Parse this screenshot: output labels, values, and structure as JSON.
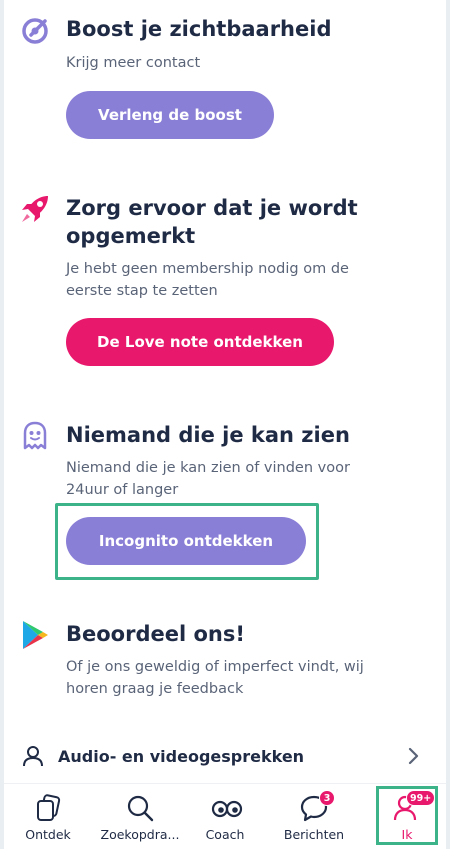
{
  "sections": [
    {
      "title": "Boost je zichtbaarheid",
      "description": "Krijg meer contact",
      "button_label": "Verleng de boost",
      "icon": "boost-icon"
    },
    {
      "title_lines": [
        "Zorg ervoor dat je wordt",
        "opgemerkt"
      ],
      "description_lines": [
        "Je hebt geen membership nodig om de",
        "eerste stap te zetten"
      ],
      "button_label": "De Love note ontdekken",
      "icon": "rocket-icon"
    },
    {
      "title": "Niemand die je kan zien",
      "description_lines": [
        "Niemand die je kan zien of vinden voor",
        "24uur of langer"
      ],
      "button_label": "Incognito ontdekken",
      "icon": "ghost-icon"
    },
    {
      "title": "Beoordeel ons!",
      "description_lines": [
        "Of je ons geweldig of imperfect vindt, wij",
        "horen graag je feedback"
      ],
      "icon": "play-store-icon"
    }
  ],
  "audio_row": {
    "label": "Audio- en videogesprekken",
    "icon": "person-icon"
  },
  "tabs": [
    {
      "label": "Ontdek",
      "icon": "cards-icon"
    },
    {
      "label": "Zoekopdra...",
      "icon": "search-icon"
    },
    {
      "label": "Coach",
      "icon": "eyes-icon"
    },
    {
      "label": "Berichten",
      "icon": "chat-icon",
      "badge": "3"
    },
    {
      "label": "Ik",
      "icon": "profile-icon",
      "badge": "99+",
      "active": true
    }
  ],
  "colors": {
    "accent_purple": "#8a7fd6",
    "accent_pink": "#e8186d",
    "highlight_green": "#3db38a",
    "text_dark": "#1f2a44"
  }
}
